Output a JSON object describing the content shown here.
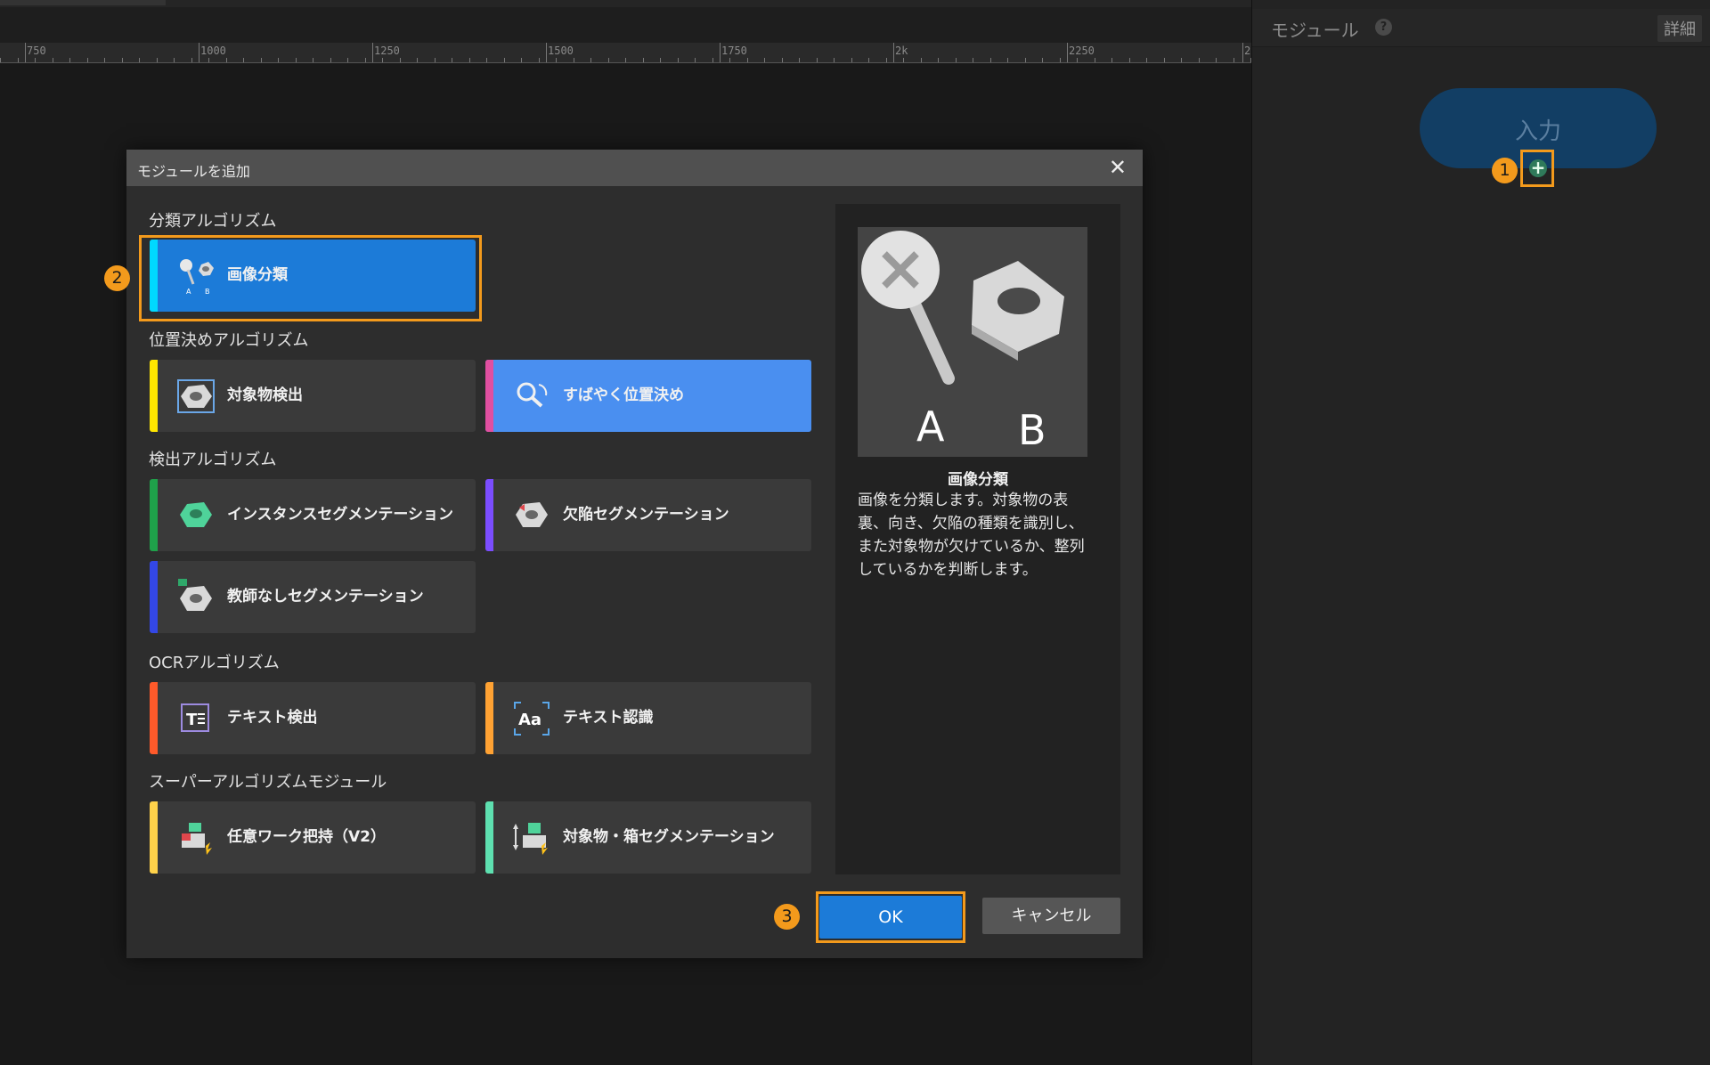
{
  "ruler": {
    "labels": [
      "750",
      "1000",
      "1250",
      "1500",
      "1750",
      "2k",
      "2250",
      "2"
    ]
  },
  "panel": {
    "title": "モジュール",
    "help_icon": "?",
    "details_label": "詳細",
    "input_node_label": "入力",
    "add_icon": "+"
  },
  "badges": {
    "b1": "1",
    "b2": "2",
    "b3": "3"
  },
  "dialog": {
    "title": "モジュールを追加",
    "close_icon": "✕",
    "categories": [
      {
        "label": "分類アルゴリズム",
        "tiles": [
          {
            "label": "画像分類",
            "stripe": "#00d9ff",
            "icon": "pin-nut-icon",
            "selected": true
          }
        ]
      },
      {
        "label": "位置決めアルゴリズム",
        "tiles": [
          {
            "label": "対象物検出",
            "stripe": "#ffe600",
            "icon": "nut-detect-icon"
          },
          {
            "label": "すばやく位置決め",
            "stripe": "#e04fa0",
            "icon": "magnifier-icon"
          }
        ]
      },
      {
        "label": "検出アルゴリズム",
        "tiles": [
          {
            "label": "インスタンスセグメンテーション",
            "stripe": "#1fa14a",
            "icon": "green-nut-icon"
          },
          {
            "label": "欠陥セグメンテーション",
            "stripe": "#7b4dff",
            "icon": "defect-nut-icon"
          },
          {
            "label": "教師なしセグメンテーション",
            "stripe": "#3347e6",
            "icon": "unsupervised-nut-icon"
          }
        ]
      },
      {
        "label": "OCRアルゴリズム",
        "tiles": [
          {
            "label": "テキスト検出",
            "stripe": "#ff5a2a",
            "icon": "text-detect-icon"
          },
          {
            "label": "テキスト認識",
            "stripe": "#ffa233",
            "icon": "text-recognize-icon"
          }
        ]
      },
      {
        "label": "スーパーアルゴリズムモジュール",
        "tiles": [
          {
            "label": "任意ワーク把持（V2）",
            "stripe": "#ffd24a",
            "icon": "grasp-icon"
          },
          {
            "label": "対象物・箱セグメンテーション",
            "stripe": "#5ee0b0",
            "icon": "box-seg-icon"
          }
        ]
      }
    ],
    "preview": {
      "image_labels": {
        "a": "A",
        "b": "B"
      },
      "name": "画像分類",
      "description": "画像を分類します。対象物の表裏、向き、欠陥の種類を識別し、また対象物が欠けているか、整列しているかを判断します。"
    },
    "ok_label": "OK",
    "cancel_label": "キャンセル"
  }
}
